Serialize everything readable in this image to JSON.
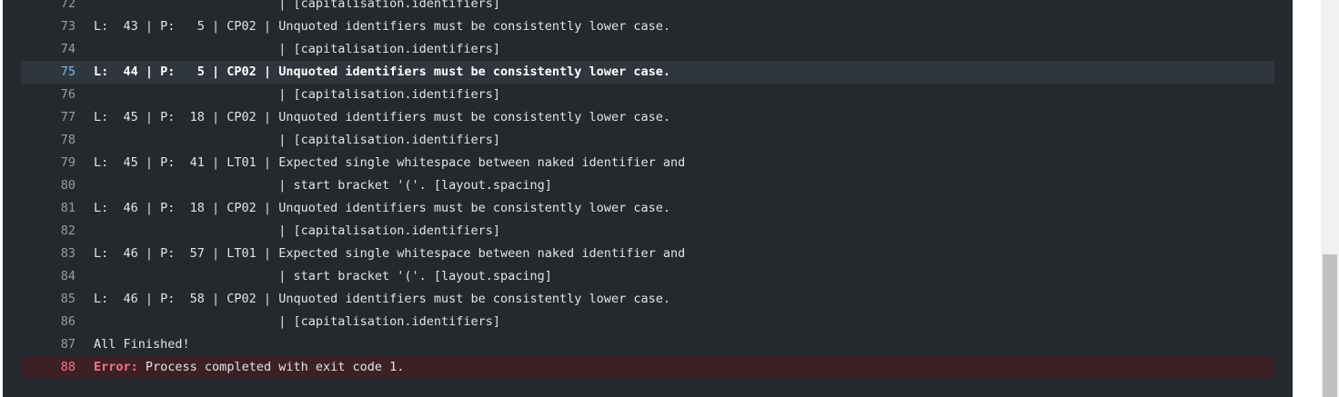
{
  "log": {
    "lines": [
      {
        "num": "72",
        "text": "                         | [capitalisation.identifiers]"
      },
      {
        "num": "73",
        "text": "L:  43 | P:   5 | CP02 | Unquoted identifiers must be consistently lower case."
      },
      {
        "num": "74",
        "text": "                         | [capitalisation.identifiers]"
      },
      {
        "num": "75",
        "text": "L:  44 | P:   5 | CP02 | Unquoted identifiers must be consistently lower case."
      },
      {
        "num": "76",
        "text": "                         | [capitalisation.identifiers]"
      },
      {
        "num": "77",
        "text": "L:  45 | P:  18 | CP02 | Unquoted identifiers must be consistently lower case."
      },
      {
        "num": "78",
        "text": "                         | [capitalisation.identifiers]"
      },
      {
        "num": "79",
        "text": "L:  45 | P:  41 | LT01 | Expected single whitespace between naked identifier and"
      },
      {
        "num": "80",
        "text": "                         | start bracket '('. [layout.spacing]"
      },
      {
        "num": "81",
        "text": "L:  46 | P:  18 | CP02 | Unquoted identifiers must be consistently lower case."
      },
      {
        "num": "82",
        "text": "                         | [capitalisation.identifiers]"
      },
      {
        "num": "83",
        "text": "L:  46 | P:  57 | LT01 | Expected single whitespace between naked identifier and"
      },
      {
        "num": "84",
        "text": "                         | start bracket '('. [layout.spacing]"
      },
      {
        "num": "85",
        "text": "L:  46 | P:  58 | CP02 | Unquoted identifiers must be consistently lower case."
      },
      {
        "num": "86",
        "text": "                         | [capitalisation.identifiers]"
      },
      {
        "num": "87",
        "text": "All Finished!"
      }
    ],
    "error_line": {
      "num": "88",
      "label": "Error:",
      "message": " Process completed with exit code 1."
    }
  },
  "colors": {
    "background": "#24292e",
    "highlight_row": "#2f363d",
    "error_row": "#3b2126",
    "error_text": "#f97583",
    "active_line_number": "#79b8ff"
  }
}
